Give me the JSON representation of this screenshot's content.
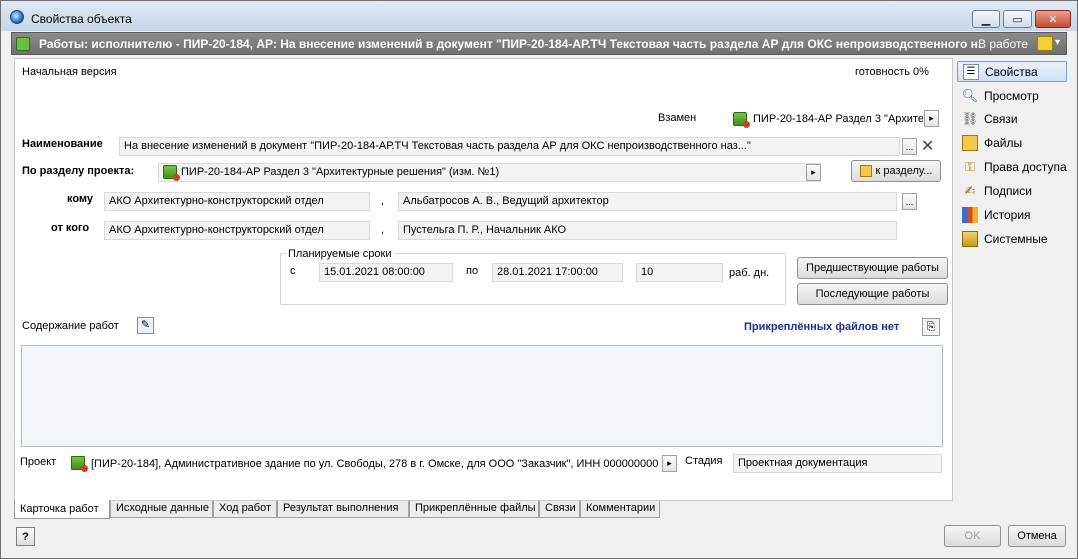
{
  "window": {
    "title": "Свойства объекта",
    "min_glyph": "▁",
    "max_glyph": "▭",
    "close_glyph": "✕"
  },
  "header": {
    "title": "Работы: исполнителю - ПИР-20-184, АР: На внесение изменений в документ \"ПИР-20-184-АР.ТЧ Текстовая часть раздела АР для ОКС непроизводственного н...",
    "status": "В работе",
    "dropdown_glyph": "▾"
  },
  "card": {
    "version": "Начальная версия",
    "readiness": "готовность 0%",
    "replaces_label": "Взамен",
    "replaces_value": "ПИР-20-184-АР Раздел 3 \"Архите",
    "name_label": "Наименование",
    "name_value": "На внесение изменений в документ \"ПИР-20-184-АР.ТЧ Текстовая часть раздела АР для ОКС непроизводственного наз...\"",
    "section_label": "По разделу проекта:",
    "section_value": "ПИР-20-184-АР Раздел 3 \"Архитектурные решения\" (изм. №1)",
    "to_section_button": "к разделу...",
    "to_label": "кому",
    "to_dept": "АКО Архитектурно-конструкторский отдел",
    "to_person": "Альбатросов А. В., Ведущий архитектор",
    "from_label": "от кого",
    "from_dept": "АКО Архитектурно-конструкторский отдел",
    "from_person": "Пустельга П. Р., Начальник АКО",
    "separator": ",",
    "ellipsis": "...",
    "arrow": "▸",
    "clear_glyph": "✕"
  },
  "schedule": {
    "group_label": "Планируемые сроки",
    "from_label": "с",
    "start": "15.01.2021 08:00:00",
    "to_label": "по",
    "end": "28.01.2021 17:00:00",
    "duration": "10",
    "unit": "раб. дн."
  },
  "actions": {
    "previous": "Предшествующие работы",
    "next": "Последующие работы"
  },
  "content": {
    "label": "Содержание работ",
    "attached": "Прикреплённых файлов нет"
  },
  "project": {
    "label": "Проект",
    "value": "[ПИР-20-184], Административное здание по ул. Свободы, 278 в г. Омске, для ООО \"Заказчик\", ИНН 000000000",
    "stage_label": "Стадия",
    "stage_value": "Проектная документация"
  },
  "tabs": [
    {
      "label": "Карточка работ"
    },
    {
      "label": "Исходные данные"
    },
    {
      "label": "Ход работ"
    },
    {
      "label": "Результат выполнения"
    },
    {
      "label": "Прикреплённые файлы"
    },
    {
      "label": "Связи"
    },
    {
      "label": "Комментарии"
    }
  ],
  "sidebar": {
    "items": [
      {
        "label": "Свойства"
      },
      {
        "label": "Просмотр"
      },
      {
        "label": "Связи"
      },
      {
        "label": "Файлы"
      },
      {
        "label": "Права доступа"
      },
      {
        "label": "Подписи"
      },
      {
        "label": "История"
      },
      {
        "label": "Системные"
      }
    ]
  },
  "footer": {
    "help": "?",
    "ok": "OK",
    "cancel": "Отмена"
  },
  "colors": {
    "header_bg": "#7a7a7a",
    "accent_link": "#1f2f8f"
  }
}
